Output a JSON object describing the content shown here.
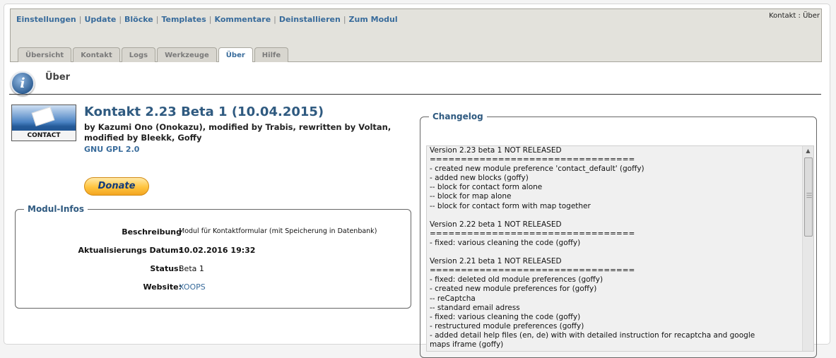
{
  "nav": {
    "links": [
      "Einstellungen",
      "Update",
      "Blöcke",
      "Templates",
      "Kommentare",
      "Deinstallieren",
      "Zum Modul"
    ],
    "separator": "|"
  },
  "breadcrumb": "Kontakt : Über",
  "tabs": [
    "Übersicht",
    "Kontakt",
    "Logs",
    "Werkzeuge",
    "Über",
    "Hilfe"
  ],
  "active_tab": "Über",
  "page": {
    "title": "Über",
    "icon": "info-icon"
  },
  "module": {
    "logo_label": "CONTACT",
    "title": "Kontakt 2.23 Beta 1 (10.04.2015)",
    "authors": "by Kazumi Ono (Onokazu), modified by Trabis, rewritten by Voltan, modified by Bleekk, Goffy",
    "license": "GNU GPL 2.0",
    "donate_label": "Donate"
  },
  "modul_infos": {
    "legend": "Modul-Infos",
    "rows": [
      {
        "label": "Beschreibung",
        "value": "Modul für Kontaktformular (mit Speicherung in Datenbank)"
      },
      {
        "label": "Aktualisierungs Datum:",
        "value": "10.02.2016 19:32"
      },
      {
        "label": "Status:",
        "value": "Beta 1"
      },
      {
        "label": "Website:",
        "value": "XOOPS"
      }
    ]
  },
  "changelog": {
    "legend": "Changelog",
    "text": "Version 2.23 beta 1 NOT RELEASED\n=================================\n- created new module preference 'contact_default' (goffy)\n- added new blocks (goffy)\n-- block for contact form alone\n-- block for map alone\n-- block for contact form with map together\n\nVersion 2.22 beta 1 NOT RELEASED\n=================================\n- fixed: various cleaning the code (goffy)\n\nVersion 2.21 beta 1 NOT RELEASED\n=================================\n- fixed: deleted old module preferences (goffy)\n- created new module preferences for (goffy)\n-- reCaptcha\n-- standard email adress\n- fixed: various cleaning the code (goffy)\n- restructured module preferences (goffy)\n- added detail help files (en, de) with with detailed instruction for recaptcha and google\nmaps iframe (goffy)"
  }
}
